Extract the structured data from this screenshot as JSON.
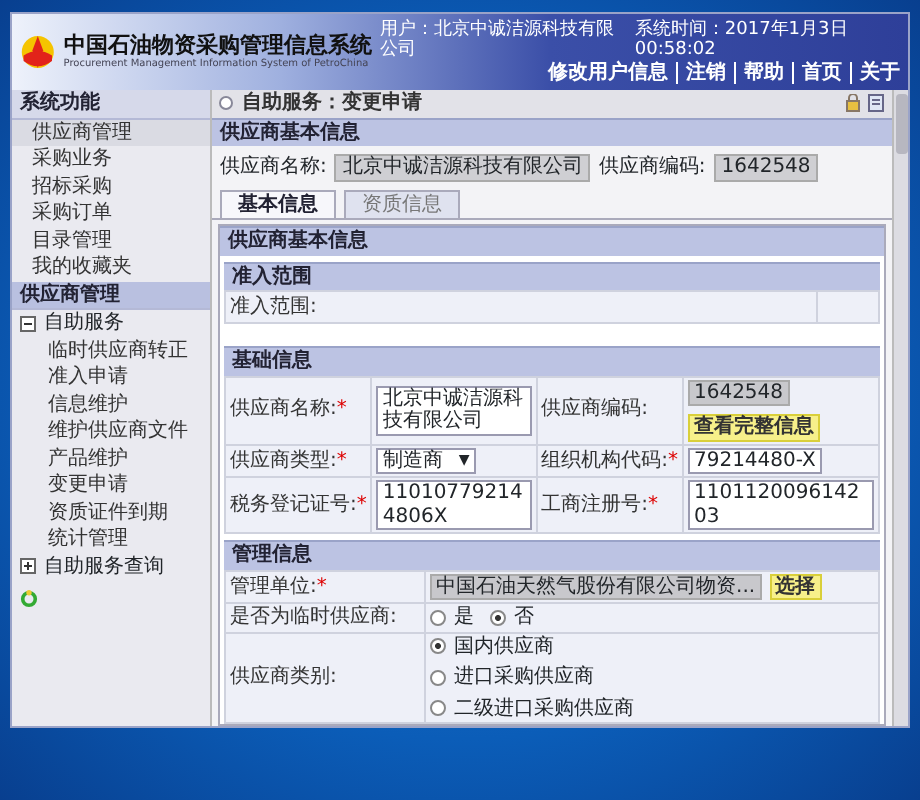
{
  "header": {
    "title": "中国石油物资采购管理信息系统",
    "subtitle": "Procurement Management Information System of PetroChina",
    "user": "用户：北京中诚洁源科技有限公司",
    "time": "系统时间：2017年1月3日 00:58:02",
    "links": [
      "修改用户信息",
      "注销",
      "帮助",
      "首页",
      "关于"
    ]
  },
  "sidebar": {
    "sections": [
      {
        "title": "系统功能",
        "expanded": false,
        "items": [
          {
            "label": "供应商管理",
            "selected": true
          },
          {
            "label": "采购业务",
            "selected": false
          },
          {
            "label": "招标采购",
            "selected": false
          },
          {
            "label": "采购订单",
            "selected": false
          },
          {
            "label": "目录管理",
            "selected": false
          },
          {
            "label": "我的收藏夹",
            "selected": false
          }
        ]
      },
      {
        "title": "供应商管理",
        "expanded": true,
        "tree": [
          {
            "label": "自助服务",
            "expanded": true,
            "children": [
              {
                "label": "临时供应商转正"
              },
              {
                "label": "准入申请"
              },
              {
                "label": "信息维护"
              },
              {
                "label": "维护供应商文件"
              },
              {
                "label": "产品维护"
              },
              {
                "label": "变更申请"
              },
              {
                "label": "资质证件到期"
              },
              {
                "label": "统计管理"
              }
            ]
          },
          {
            "label": "自助服务查询",
            "expanded": false
          }
        ]
      }
    ]
  },
  "breadcrumb": "自助服务：变更申请",
  "supplier_bar": {
    "title": "供应商基本信息",
    "fields": [
      {
        "label": "供应商名称:",
        "value": "北京中诚洁源科技有限公司"
      },
      {
        "label": "供应商编码:",
        "value": "1642548"
      }
    ]
  },
  "tabs": [
    {
      "label": "基本信息",
      "selected": true
    },
    {
      "label": "资质信息",
      "selected": false
    }
  ],
  "panel": {
    "title": "供应商基本信息",
    "sections": [
      {
        "title": "准入范围",
        "rows": [
          [
            {
              "kind": "text",
              "label": "准入范围:"
            }
          ]
        ]
      },
      {
        "title": "基础信息",
        "rows": [
          [
            {
              "kind": "input",
              "label": "供应商名称:",
              "mark": "*",
              "value": "北京中诚洁源科技有限公司"
            },
            {
              "kind": "readonly",
              "label": "供应商编码:",
              "value": "1642548",
              "action": "查看完整信息"
            }
          ],
          [
            {
              "kind": "select",
              "label": "供应商类型:",
              "mark": "*",
              "value": "制造商",
              "caret": "▼"
            },
            {
              "kind": "input",
              "label": "组织机构代码:",
              "mark": "*",
              "value": "79214480-X"
            }
          ],
          [
            {
              "kind": "input",
              "label": "税务登记证号:",
              "mark": "*",
              "value": "110107792144806X"
            },
            {
              "kind": "input",
              "label": "工商注册号:",
              "mark": "*",
              "value": "110112009614203"
            }
          ]
        ]
      },
      {
        "title": "管理信息",
        "rows": [
          [
            {
              "kind": "readonly",
              "label": "管理单位:",
              "mark": "*",
              "value": "中国石油天然气股份有限公司物资...",
              "action": "选择"
            }
          ],
          [
            {
              "kind": "radio-row",
              "label": "是否为临时供应商:",
              "options": [
                {
                  "label": "是",
                  "selected": false
                },
                {
                  "label": "否",
                  "selected": true
                }
              ]
            }
          ],
          [
            {
              "kind": "radio-column",
              "label": "供应商类别:",
              "options": [
                {
                  "label": "国内供应商",
                  "selected": true
                },
                {
                  "label": "进口采购供应商",
                  "selected": false
                },
                {
                  "label": "二级进口采购供应商",
                  "selected": false
                }
              ]
            }
          ]
        ]
      }
    ]
  }
}
